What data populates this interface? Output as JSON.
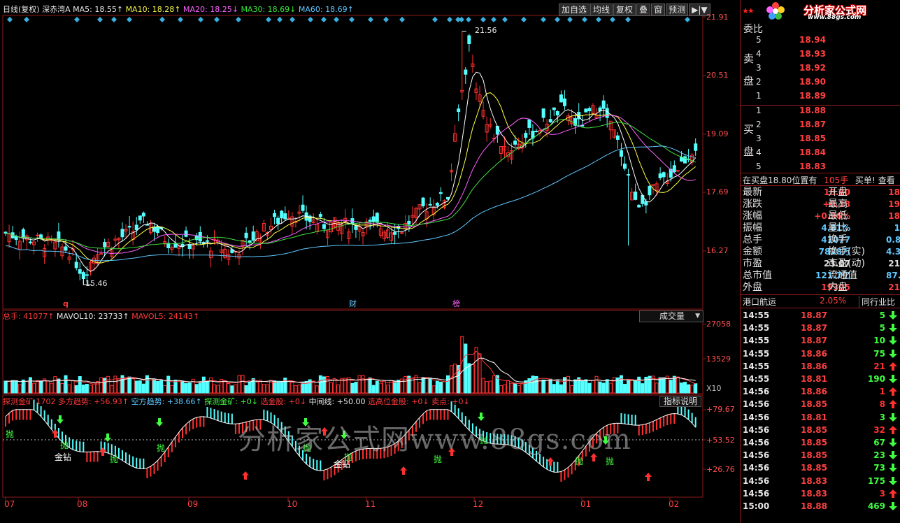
{
  "header": {
    "period": "日线(复权)",
    "stock": "深赤湾A",
    "ma5": "MA5: 18.55↑",
    "ma10": "MA10: 18.28↑",
    "ma20": "MA20: 18.25↓",
    "ma30": "MA30: 18.69↓",
    "ma60": "MA60: 18.69↑"
  },
  "toolbar": [
    "加自选",
    "均线",
    "复权",
    "叠",
    "窗",
    "预测",
    "▶|▼"
  ],
  "price_axis": [
    "21.91",
    "20.51",
    "19.09",
    "17.69",
    "16.27"
  ],
  "price_marks": {
    "high": "21.56",
    "low": "15.46"
  },
  "event_marks": {
    "q": "q",
    "cai": "财",
    "bang": "榜"
  },
  "volume": {
    "total": "总手: 41077↑",
    "mavol10": "MAVOL10: 23733↑",
    "mavol5": "MAVOL5: 24143↑",
    "axis": [
      "27058",
      "13529"
    ],
    "unit": "X10",
    "dropdown": "成交量"
  },
  "indicator": {
    "name": "探测金矿 1702",
    "dd": "多方趋势: +56.93↑",
    "kf": "空方趋势: +38.66↑",
    "tc": "探测金矿: +0↓",
    "xj": "选金股: +0↓",
    "zj": "中间线: +50.00",
    "xg": "选高位金股: +0↓",
    "md": "卖点: +0↓",
    "button": "指标说明",
    "axis": [
      "+79.67",
      "+53.52",
      "+26.76"
    ],
    "sell": "抛",
    "gold": "金钻"
  },
  "time_axis": [
    "07",
    "08",
    "09",
    "10",
    "11",
    "12",
    "01",
    "02"
  ],
  "watermark": "分析家公式网www.88gs.com",
  "logo": {
    "brand": "分析家公式网",
    "url": "www.88gs.com"
  },
  "orderbook": {
    "wei_label": "委比",
    "sell_label_1": "卖",
    "sell_label_2": "盘",
    "buy_label_1": "买",
    "buy_label_2": "盘",
    "sells": [
      {
        "lv": "5",
        "px": "18.94"
      },
      {
        "lv": "4",
        "px": "18.93"
      },
      {
        "lv": "3",
        "px": "18.92"
      },
      {
        "lv": "2",
        "px": "18.90"
      },
      {
        "lv": "1",
        "px": "18.89"
      }
    ],
    "buys": [
      {
        "lv": "1",
        "px": "18.88"
      },
      {
        "lv": "2",
        "px": "18.87"
      },
      {
        "lv": "3",
        "px": "18.85"
      },
      {
        "lv": "4",
        "px": "18.84"
      },
      {
        "lv": "5",
        "px": "18.83"
      }
    ],
    "position_text": "在买盘18.80位置有",
    "position_qty": "105手",
    "buy_list": "买单!",
    "view": "查看"
  },
  "quote": [
    {
      "k1": "最新",
      "v1": "18.80",
      "c1": "#ff4040",
      "k2": "开盘",
      "v2": "18"
    },
    {
      "k1": "涨跌",
      "v1": "+0.18",
      "c1": "#ff4040",
      "k2": "最高",
      "v2": "19"
    },
    {
      "k1": "涨幅",
      "v1": "+0.96%",
      "c1": "#ff4040",
      "k2": "最低",
      "v2": "18"
    },
    {
      "k1": "振幅",
      "v1": "4.81%",
      "c1": "#60c8ff",
      "k2": "量比",
      "v2": "1"
    },
    {
      "k1": "总手",
      "v1": "41077",
      "c1": "#60c8ff",
      "k2": "换手",
      "v2": "0.8"
    },
    {
      "k1": "金额",
      "v1": "7828万",
      "c1": "#60c8ff",
      "k2": "换手(实)",
      "v2": "4.3"
    },
    {
      "k1": "市盈",
      "v1": "23.07",
      "c1": "#e0e0e0",
      "k2": "市盈(动)",
      "v2": "21"
    },
    {
      "k1": "总市值",
      "v1": "121.7亿",
      "c1": "#60c8ff",
      "k2": "流通值",
      "v2": "87.7"
    },
    {
      "k1": "外盘",
      "v1": "19305",
      "c1": "#ff4040",
      "k2": "内盘",
      "v2": "21"
    }
  ],
  "sector": {
    "name": "港口航运",
    "pct": "2.05%",
    "compare": "同行业比"
  },
  "ticks": [
    {
      "t": "14:55",
      "p": "18.87",
      "v": "5",
      "d": "down"
    },
    {
      "t": "14:55",
      "p": "18.87",
      "v": "5",
      "d": "down"
    },
    {
      "t": "14:55",
      "p": "18.87",
      "v": "10",
      "d": "down"
    },
    {
      "t": "14:55",
      "p": "18.86",
      "v": "75",
      "d": "down"
    },
    {
      "t": "14:55",
      "p": "18.86",
      "v": "21",
      "d": "up"
    },
    {
      "t": "14:55",
      "p": "18.81",
      "v": "190",
      "d": "down"
    },
    {
      "t": "14:56",
      "p": "18.86",
      "v": "1",
      "d": "up"
    },
    {
      "t": "14:56",
      "p": "18.85",
      "v": "8",
      "d": "up"
    },
    {
      "t": "14:56",
      "p": "18.81",
      "v": "3",
      "d": "down"
    },
    {
      "t": "14:56",
      "p": "18.85",
      "v": "32",
      "d": "up"
    },
    {
      "t": "14:56",
      "p": "18.85",
      "v": "67",
      "d": "down"
    },
    {
      "t": "14:56",
      "p": "18.85",
      "v": "23",
      "d": "down"
    },
    {
      "t": "14:56",
      "p": "18.85",
      "v": "73",
      "d": "down"
    },
    {
      "t": "14:56",
      "p": "18.83",
      "v": "175",
      "d": "down"
    },
    {
      "t": "14:56",
      "p": "18.83",
      "v": "3",
      "d": "up"
    },
    {
      "t": "15:00",
      "p": "18.88",
      "v": "469",
      "d": "down"
    }
  ],
  "colors": {
    "up": "#ff3030",
    "down": "#54ffff",
    "ma5": "#ffffff",
    "ma10": "#ffff40",
    "ma20": "#ff60ff",
    "ma30": "#40e040",
    "ma60": "#60c8ff",
    "border": "#8b1a1a"
  }
}
